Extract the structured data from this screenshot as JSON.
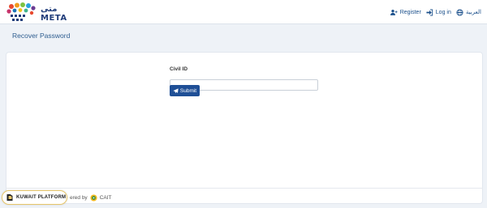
{
  "brand": {
    "logo_text": "META",
    "logo_arabic": "متى"
  },
  "nav": {
    "register": "Register",
    "login": "Log in",
    "language": "العربية"
  },
  "page": {
    "title": "Recover Password"
  },
  "form": {
    "civil_id_label": "Civil ID",
    "civil_id_value": "",
    "submit_label": "Submit"
  },
  "footer": {
    "powered_by": "ered by",
    "powered_org": "CAIT",
    "platform_badge": "KUWAIT PLATFORM"
  },
  "colors": {
    "primary": "#1f4f96",
    "title": "#2e5d8f",
    "background": "#eef2f7"
  }
}
